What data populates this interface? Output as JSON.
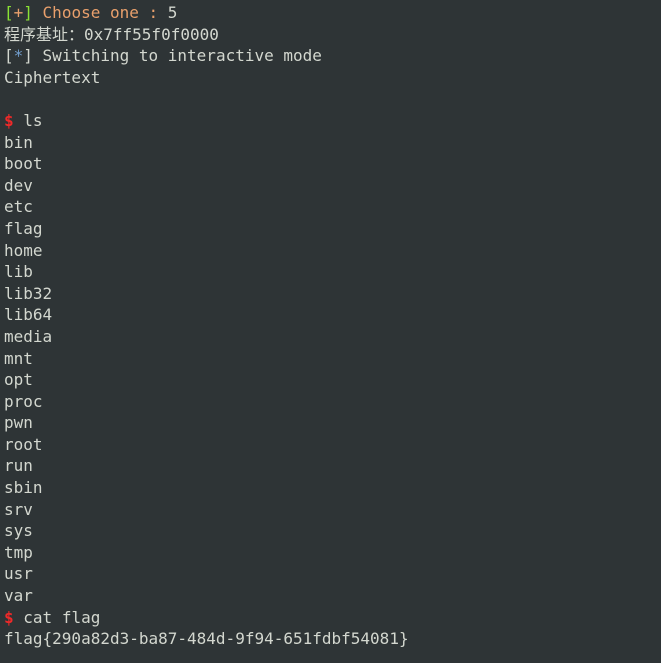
{
  "header": {
    "bracket_open": "[",
    "plus": "+",
    "bracket_close": "] ",
    "choose_label": "Choose one : ",
    "choice_value": "5"
  },
  "base_addr_line": "程序基址：0x7ff55f0f0000",
  "switch_line": {
    "bracket_open": "[",
    "star": "*",
    "bracket_close": "] ",
    "text": "Switching to interactive mode"
  },
  "ciphertext_label": "Ciphertext",
  "prompt": "$",
  "commands": {
    "ls": "ls",
    "cat_flag": "cat flag"
  },
  "ls_output": [
    "bin",
    "boot",
    "dev",
    "etc",
    "flag",
    "home",
    "lib",
    "lib32",
    "lib64",
    "media",
    "mnt",
    "opt",
    "proc",
    "pwn",
    "root",
    "run",
    "sbin",
    "srv",
    "sys",
    "tmp",
    "usr",
    "var"
  ],
  "flag_output": "flag{290a82d3-ba87-484d-9f94-651fdbf54081}"
}
